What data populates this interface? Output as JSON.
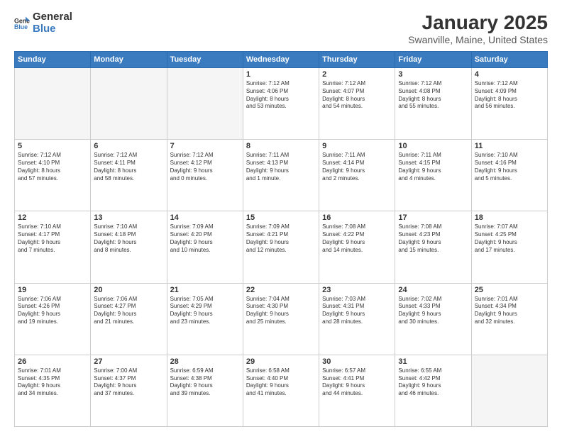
{
  "logo": {
    "general": "General",
    "blue": "Blue"
  },
  "header": {
    "month": "January 2025",
    "location": "Swanville, Maine, United States"
  },
  "days_of_week": [
    "Sunday",
    "Monday",
    "Tuesday",
    "Wednesday",
    "Thursday",
    "Friday",
    "Saturday"
  ],
  "weeks": [
    [
      {
        "day": "",
        "info": ""
      },
      {
        "day": "",
        "info": ""
      },
      {
        "day": "",
        "info": ""
      },
      {
        "day": "1",
        "info": "Sunrise: 7:12 AM\nSunset: 4:06 PM\nDaylight: 8 hours\nand 53 minutes."
      },
      {
        "day": "2",
        "info": "Sunrise: 7:12 AM\nSunset: 4:07 PM\nDaylight: 8 hours\nand 54 minutes."
      },
      {
        "day": "3",
        "info": "Sunrise: 7:12 AM\nSunset: 4:08 PM\nDaylight: 8 hours\nand 55 minutes."
      },
      {
        "day": "4",
        "info": "Sunrise: 7:12 AM\nSunset: 4:09 PM\nDaylight: 8 hours\nand 56 minutes."
      }
    ],
    [
      {
        "day": "5",
        "info": "Sunrise: 7:12 AM\nSunset: 4:10 PM\nDaylight: 8 hours\nand 57 minutes."
      },
      {
        "day": "6",
        "info": "Sunrise: 7:12 AM\nSunset: 4:11 PM\nDaylight: 8 hours\nand 58 minutes."
      },
      {
        "day": "7",
        "info": "Sunrise: 7:12 AM\nSunset: 4:12 PM\nDaylight: 9 hours\nand 0 minutes."
      },
      {
        "day": "8",
        "info": "Sunrise: 7:11 AM\nSunset: 4:13 PM\nDaylight: 9 hours\nand 1 minute."
      },
      {
        "day": "9",
        "info": "Sunrise: 7:11 AM\nSunset: 4:14 PM\nDaylight: 9 hours\nand 2 minutes."
      },
      {
        "day": "10",
        "info": "Sunrise: 7:11 AM\nSunset: 4:15 PM\nDaylight: 9 hours\nand 4 minutes."
      },
      {
        "day": "11",
        "info": "Sunrise: 7:10 AM\nSunset: 4:16 PM\nDaylight: 9 hours\nand 5 minutes."
      }
    ],
    [
      {
        "day": "12",
        "info": "Sunrise: 7:10 AM\nSunset: 4:17 PM\nDaylight: 9 hours\nand 7 minutes."
      },
      {
        "day": "13",
        "info": "Sunrise: 7:10 AM\nSunset: 4:18 PM\nDaylight: 9 hours\nand 8 minutes."
      },
      {
        "day": "14",
        "info": "Sunrise: 7:09 AM\nSunset: 4:20 PM\nDaylight: 9 hours\nand 10 minutes."
      },
      {
        "day": "15",
        "info": "Sunrise: 7:09 AM\nSunset: 4:21 PM\nDaylight: 9 hours\nand 12 minutes."
      },
      {
        "day": "16",
        "info": "Sunrise: 7:08 AM\nSunset: 4:22 PM\nDaylight: 9 hours\nand 14 minutes."
      },
      {
        "day": "17",
        "info": "Sunrise: 7:08 AM\nSunset: 4:23 PM\nDaylight: 9 hours\nand 15 minutes."
      },
      {
        "day": "18",
        "info": "Sunrise: 7:07 AM\nSunset: 4:25 PM\nDaylight: 9 hours\nand 17 minutes."
      }
    ],
    [
      {
        "day": "19",
        "info": "Sunrise: 7:06 AM\nSunset: 4:26 PM\nDaylight: 9 hours\nand 19 minutes."
      },
      {
        "day": "20",
        "info": "Sunrise: 7:06 AM\nSunset: 4:27 PM\nDaylight: 9 hours\nand 21 minutes."
      },
      {
        "day": "21",
        "info": "Sunrise: 7:05 AM\nSunset: 4:29 PM\nDaylight: 9 hours\nand 23 minutes."
      },
      {
        "day": "22",
        "info": "Sunrise: 7:04 AM\nSunset: 4:30 PM\nDaylight: 9 hours\nand 25 minutes."
      },
      {
        "day": "23",
        "info": "Sunrise: 7:03 AM\nSunset: 4:31 PM\nDaylight: 9 hours\nand 28 minutes."
      },
      {
        "day": "24",
        "info": "Sunrise: 7:02 AM\nSunset: 4:33 PM\nDaylight: 9 hours\nand 30 minutes."
      },
      {
        "day": "25",
        "info": "Sunrise: 7:01 AM\nSunset: 4:34 PM\nDaylight: 9 hours\nand 32 minutes."
      }
    ],
    [
      {
        "day": "26",
        "info": "Sunrise: 7:01 AM\nSunset: 4:35 PM\nDaylight: 9 hours\nand 34 minutes."
      },
      {
        "day": "27",
        "info": "Sunrise: 7:00 AM\nSunset: 4:37 PM\nDaylight: 9 hours\nand 37 minutes."
      },
      {
        "day": "28",
        "info": "Sunrise: 6:59 AM\nSunset: 4:38 PM\nDaylight: 9 hours\nand 39 minutes."
      },
      {
        "day": "29",
        "info": "Sunrise: 6:58 AM\nSunset: 4:40 PM\nDaylight: 9 hours\nand 41 minutes."
      },
      {
        "day": "30",
        "info": "Sunrise: 6:57 AM\nSunset: 4:41 PM\nDaylight: 9 hours\nand 44 minutes."
      },
      {
        "day": "31",
        "info": "Sunrise: 6:55 AM\nSunset: 4:42 PM\nDaylight: 9 hours\nand 46 minutes."
      },
      {
        "day": "",
        "info": ""
      }
    ]
  ]
}
